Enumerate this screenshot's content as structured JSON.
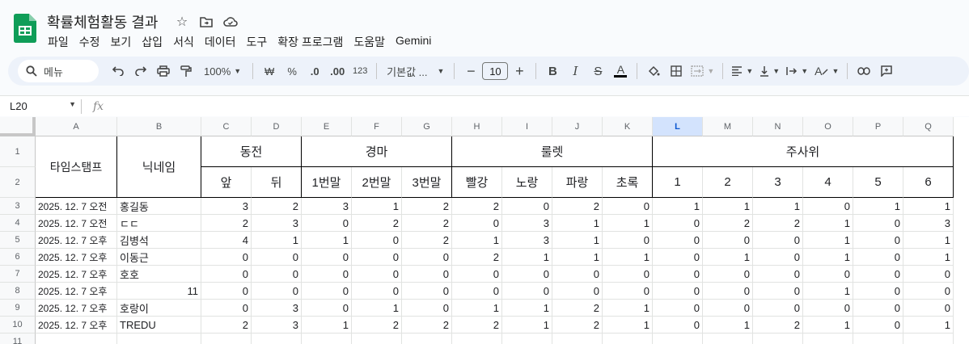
{
  "app": {
    "title": "확률체험활동 결과",
    "menu": [
      "파일",
      "수정",
      "보기",
      "삽입",
      "서식",
      "데이터",
      "도구",
      "확장 프로그램",
      "도움말",
      "Gemini"
    ]
  },
  "toolbar": {
    "search": "메뉴",
    "zoom": "100%",
    "currency": "₩",
    "percent": "%",
    "dec_decrease": ".0",
    "dec_increase": ".00",
    "number_format": "123",
    "font": "기본값 ...",
    "font_size": "10"
  },
  "formula_bar": {
    "cell_ref": "L20",
    "fx": "fx"
  },
  "columns": [
    "A",
    "B",
    "C",
    "D",
    "E",
    "F",
    "G",
    "H",
    "I",
    "J",
    "K",
    "L",
    "M",
    "N",
    "O",
    "P",
    "Q"
  ],
  "selected_column": "L",
  "rows": [
    "1",
    "2",
    "3",
    "4",
    "5",
    "6",
    "7",
    "8",
    "9",
    "10",
    "11"
  ],
  "headers": {
    "timestamp": "타임스탬프",
    "nickname": "닉네임",
    "coin": "동전",
    "race": "경마",
    "roulette": "룰렛",
    "dice": "주사위",
    "sub": [
      "앞",
      "뒤",
      "1번말",
      "2번말",
      "3번말",
      "빨강",
      "노랑",
      "파랑",
      "초록",
      "1",
      "2",
      "3",
      "4",
      "5",
      "6"
    ]
  },
  "data": [
    {
      "ts": "2025. 12. 7 오전",
      "name": "홍길동",
      "vals": [
        "3",
        "2",
        "3",
        "1",
        "2",
        "2",
        "0",
        "2",
        "0",
        "1",
        "1",
        "1",
        "0",
        "1",
        "1"
      ]
    },
    {
      "ts": "2025. 12. 7 오전",
      "name": "ㄷㄷ",
      "vals": [
        "2",
        "3",
        "0",
        "2",
        "2",
        "0",
        "3",
        "1",
        "1",
        "0",
        "2",
        "2",
        "1",
        "0",
        "3"
      ]
    },
    {
      "ts": "2025. 12. 7 오후",
      "name": "김병석",
      "vals": [
        "4",
        "1",
        "1",
        "0",
        "2",
        "1",
        "3",
        "1",
        "0",
        "0",
        "0",
        "0",
        "1",
        "0",
        "1"
      ]
    },
    {
      "ts": "2025. 12. 7 오후",
      "name": "이동근",
      "vals": [
        "0",
        "0",
        "0",
        "0",
        "0",
        "2",
        "1",
        "1",
        "1",
        "0",
        "1",
        "0",
        "1",
        "0",
        "1"
      ]
    },
    {
      "ts": "2025. 12. 7 오후",
      "name": "호호",
      "vals": [
        "0",
        "0",
        "0",
        "0",
        "0",
        "0",
        "0",
        "0",
        "0",
        "0",
        "0",
        "0",
        "0",
        "0",
        "0"
      ]
    },
    {
      "ts": "2025. 12. 7 오후",
      "name": "11",
      "vals": [
        "0",
        "0",
        "0",
        "0",
        "0",
        "0",
        "0",
        "0",
        "0",
        "0",
        "0",
        "0",
        "1",
        "0",
        "0"
      ]
    },
    {
      "ts": "2025. 12. 7 오후",
      "name": "호랑이",
      "vals": [
        "0",
        "3",
        "0",
        "1",
        "0",
        "1",
        "1",
        "2",
        "1",
        "0",
        "0",
        "0",
        "0",
        "0",
        "0"
      ]
    },
    {
      "ts": "2025. 12. 7 오후",
      "name": "TREDU",
      "vals": [
        "2",
        "3",
        "1",
        "2",
        "2",
        "2",
        "1",
        "2",
        "1",
        "0",
        "1",
        "2",
        "1",
        "0",
        "1"
      ]
    }
  ],
  "name_numeric_rows": [
    5
  ]
}
